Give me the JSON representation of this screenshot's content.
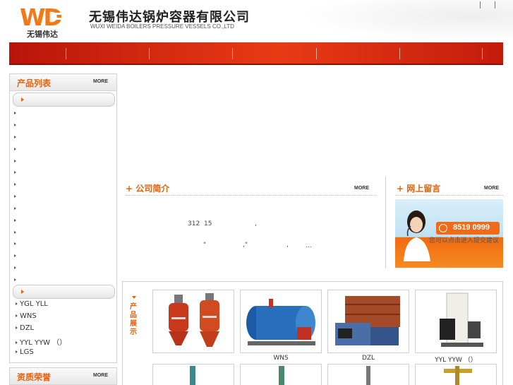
{
  "header": {
    "logo_mark": "WD",
    "logo_cn": "无锡伟达",
    "company_cn": "无锡伟达锅炉容器有限公司",
    "company_en": "WUXI WEIDA BOILERS PRESSURE VESSELS CO.,LTD"
  },
  "product_panel": {
    "title": "产品列表",
    "more": "MORE",
    "items": [
      "YGL YLL",
      "WNS",
      "DZL",
      "YYL YYW （）",
      "LGS"
    ]
  },
  "honor_panel": {
    "title": "资质荣誉",
    "more": "MORE"
  },
  "about": {
    "title": "公司简介",
    "more": "MORE",
    "line1_a": "312",
    "line1_b": "15",
    "line1_c": ",",
    "line2_a": "\"",
    "line2_b": ",\"",
    "line2_c": ",",
    "line2_d": "..."
  },
  "message": {
    "title": "网上留言",
    "more": "MORE",
    "phone": "8519 0999",
    "hint": "您可以点击进入提交建议"
  },
  "showcase": {
    "label": "产品展示",
    "items": [
      {
        "label": ""
      },
      {
        "label": "WNS"
      },
      {
        "label": "DZL"
      },
      {
        "label": "YYL YYW （）"
      }
    ]
  },
  "colors": {
    "accent": "#e8600a",
    "nav_red": "#d42a10"
  }
}
